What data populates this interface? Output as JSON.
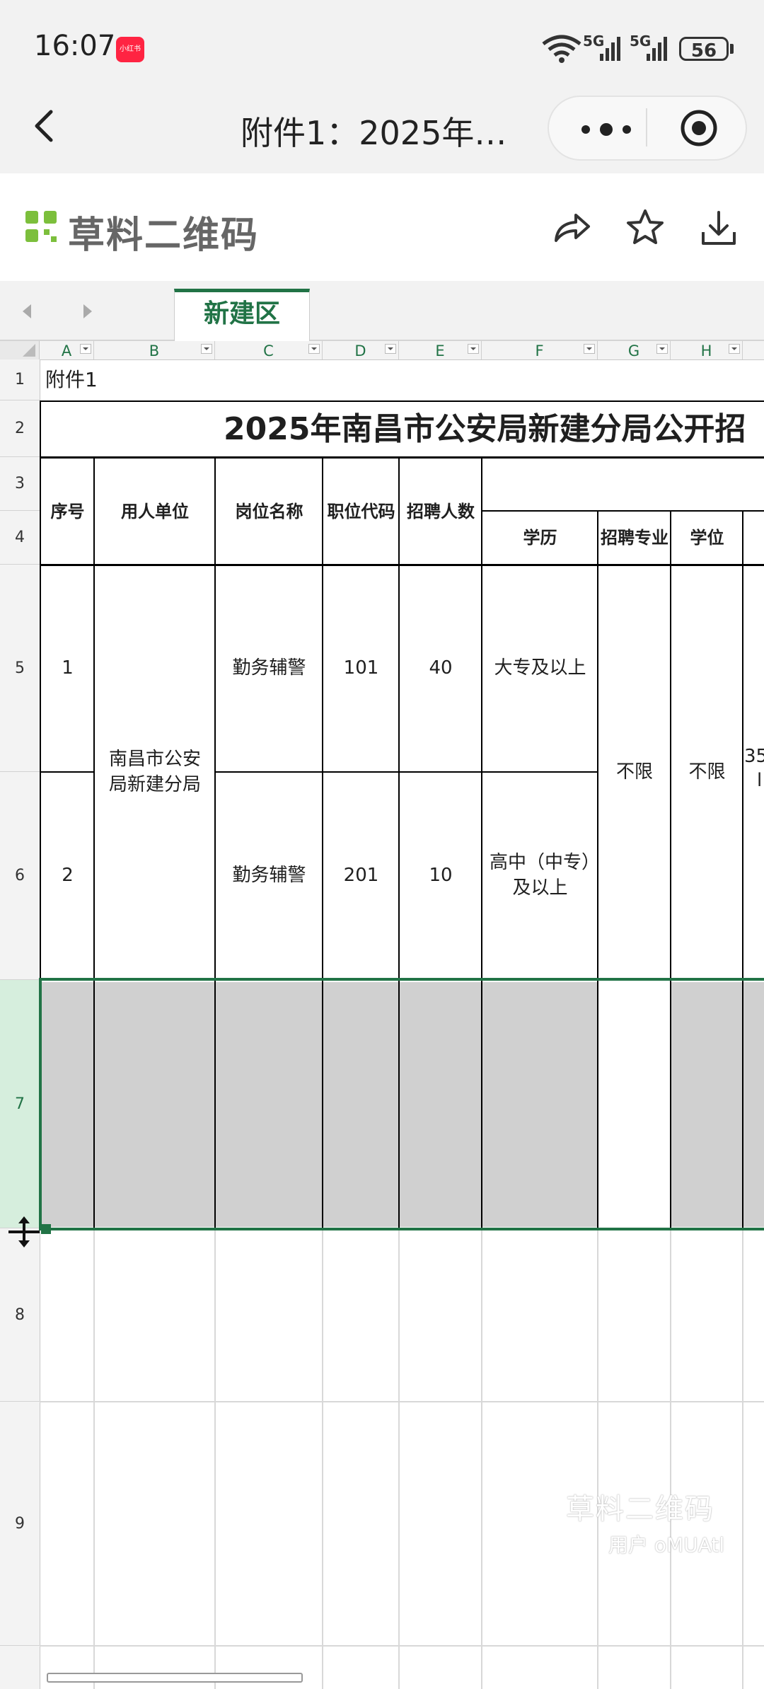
{
  "status_bar": {
    "time": "16:07",
    "app_badge": "小红书",
    "network": "5G",
    "battery": "56"
  },
  "nav": {
    "title": "附件1：2025年…"
  },
  "brand": {
    "name": "草料二维码"
  },
  "sheet": {
    "tab_name": "新建区",
    "columns": [
      "A",
      "B",
      "C",
      "D",
      "E",
      "F",
      "G",
      "H"
    ],
    "rows": [
      "1",
      "2",
      "3",
      "4",
      "5",
      "6",
      "7",
      "8",
      "9"
    ],
    "a1": "附件1",
    "title": "2025年南昌市公安局新建分局公开招",
    "headers": {
      "seq": "序号",
      "unit": "用人单位",
      "post": "岗位名称",
      "code": "职位代码",
      "count": "招聘人数",
      "edu": "学历",
      "major": "招聘专业",
      "degree": "学位",
      "extra": "35"
    },
    "records": [
      {
        "seq": "1",
        "post": "勤务辅警",
        "code": "101",
        "count": "40",
        "edu": "大专及以上"
      },
      {
        "seq": "2",
        "post": "勤务辅警",
        "code": "201",
        "count": "10",
        "edu": "高中（中专）及以上"
      }
    ],
    "unit_merged": "南昌市公安局新建分局",
    "major_merged": "不限",
    "degree_merged": "不限",
    "extra_cut": "l"
  },
  "watermark": {
    "line1": "草料二维码",
    "line2": "用户 oMUAtl"
  }
}
